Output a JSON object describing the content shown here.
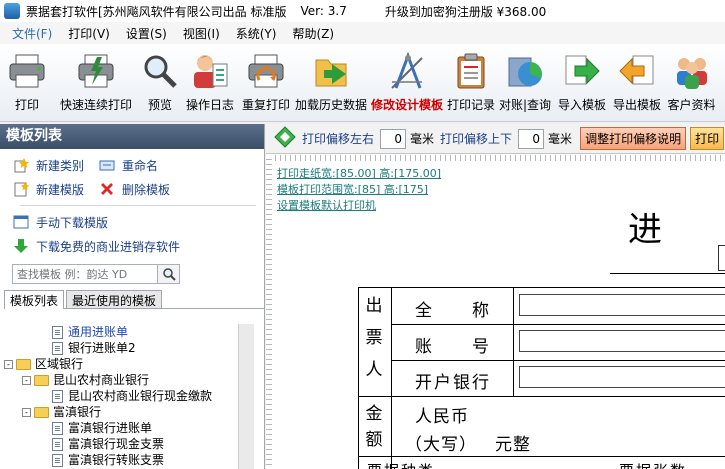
{
  "title_bar": {
    "app": "票据套打软件[苏州飚风软件有限公司出品 标准版",
    "version": "Ver: 3.7",
    "upgrade": "升级到加密狗注册版 ¥368.00"
  },
  "menu": [
    "文件(F)",
    "打印(V)",
    "设置(S)",
    "视图(I)",
    "系统(Y)",
    "帮助(Z)"
  ],
  "toolbar": [
    {
      "label": "打印",
      "icon": "printer-icon"
    },
    {
      "label": "快速连续打印",
      "icon": "fast-print-icon"
    },
    {
      "label": "预览",
      "icon": "magnifier-icon"
    },
    {
      "label": "操作日志",
      "icon": "operator-log-icon"
    },
    {
      "label": "重复打印",
      "icon": "repeat-print-icon"
    },
    {
      "label": "加载历史数据",
      "icon": "folder-load-icon"
    },
    {
      "label": "修改设计模板",
      "icon": "design-compass-icon",
      "accent": true
    },
    {
      "label": "打印记录",
      "icon": "clipboard-icon"
    },
    {
      "label": "对账|查询",
      "icon": "chart-folder-icon"
    },
    {
      "label": "导入模板",
      "icon": "import-arrow-icon"
    },
    {
      "label": "导出模板",
      "icon": "export-arrow-icon"
    },
    {
      "label": "客户资料",
      "icon": "customers-icon"
    }
  ],
  "left_panel": {
    "title": "模板列表",
    "actions": {
      "new_category": "新建类别",
      "rename": "重命名",
      "new_template": "新建模版",
      "delete_template": "删除模板",
      "manual_download": "手动下载模版",
      "free_download": "下载免费的商业进销存软件"
    },
    "search_placeholder": "查找模板 例：韵达 YD",
    "tabs": [
      "模板列表",
      "最近使用的模板"
    ],
    "tree": [
      {
        "label": "通用进账单",
        "level": 2,
        "type": "doc",
        "selected": true
      },
      {
        "label": "银行进账单2",
        "level": 2,
        "type": "doc"
      },
      {
        "label": "区域银行",
        "level": 0,
        "type": "folder",
        "toggle": "-"
      },
      {
        "label": "昆山农村商业银行",
        "level": 1,
        "type": "folder",
        "toggle": "-"
      },
      {
        "label": "昆山农村商业银行现金缴款",
        "level": 2,
        "type": "doc"
      },
      {
        "label": "富滇银行",
        "level": 1,
        "type": "folder",
        "toggle": "-"
      },
      {
        "label": "富滇银行进账单",
        "level": 2,
        "type": "doc"
      },
      {
        "label": "富滇银行现金支票",
        "level": 2,
        "type": "doc"
      },
      {
        "label": "富滇银行转账支票",
        "level": 2,
        "type": "doc"
      }
    ]
  },
  "right_toolbar": {
    "offset_lr_label": "打印偏移左右",
    "offset_lr_value": "0",
    "unit1": "毫米",
    "offset_ud_label": "打印偏移上下",
    "offset_ud_value": "0",
    "unit2": "毫米",
    "adjust_button": "调整打印偏移说明",
    "print_button": "打印"
  },
  "design": {
    "links": [
      "打印走纸宽:[85.00] 高:[175.00]",
      "模板打印范围宽:[85] 高:[175]",
      "设置模板默认打印机"
    ],
    "title": "进",
    "form": {
      "section1": [
        "出",
        "票",
        "人"
      ],
      "rows1": [
        "全　　称",
        "账　　号",
        "开户银行"
      ],
      "section2": [
        "金",
        "额"
      ],
      "rmb": "人民币",
      "daxie": "（大写）",
      "yuanzheng": "元整",
      "bottom": [
        "票据种类",
        "票据张数"
      ]
    }
  }
}
